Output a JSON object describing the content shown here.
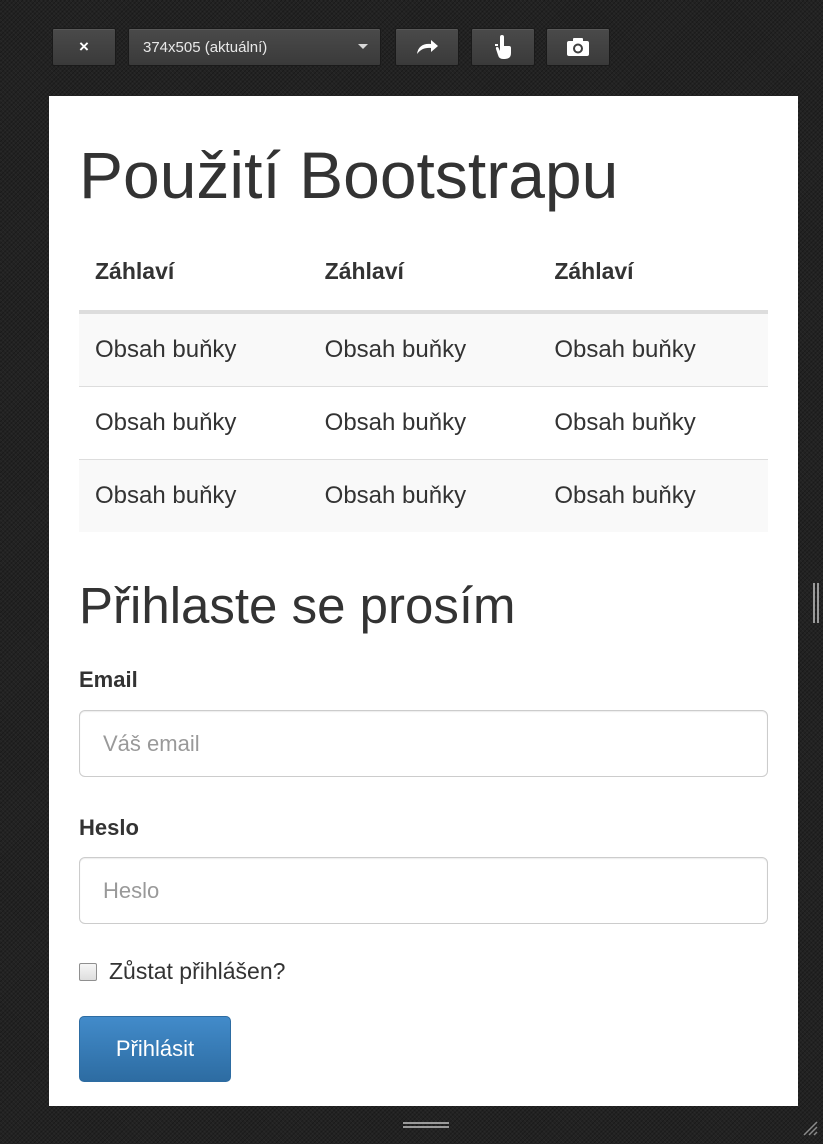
{
  "toolbar": {
    "close_label": "×",
    "close_icon": "close-icon",
    "size_select": "374x505 (aktuální)",
    "size_options": [
      "374x505 (aktuální)"
    ],
    "rotate_icon": "rotate-icon",
    "touch_icon": "touch-icon",
    "screenshot_icon": "camera-icon"
  },
  "page": {
    "title": "Použití Bootstrapu",
    "table": {
      "headers": [
        "Záhlaví",
        "Záhlaví",
        "Záhlaví"
      ],
      "rows": [
        [
          "Obsah buňky",
          "Obsah buňky",
          "Obsah buňky"
        ],
        [
          "Obsah buňky",
          "Obsah buňky",
          "Obsah buňky"
        ],
        [
          "Obsah buňky",
          "Obsah buňky",
          "Obsah buňky"
        ]
      ]
    },
    "form": {
      "title": "Přihlaste se prosím",
      "email_label": "Email",
      "email_placeholder": "Váš email",
      "email_value": "",
      "password_label": "Heslo",
      "password_placeholder": "Heslo",
      "password_value": "",
      "remember_label": "Zůstat přihlášen?",
      "remember_checked": false,
      "submit_label": "Přihlásit"
    }
  },
  "colors": {
    "background": "#222222",
    "toolbar_button": "#3f3f3f",
    "primary": "#428bca",
    "text": "#333333",
    "table_stripe": "#f9f9f9",
    "border": "#dddddd"
  }
}
